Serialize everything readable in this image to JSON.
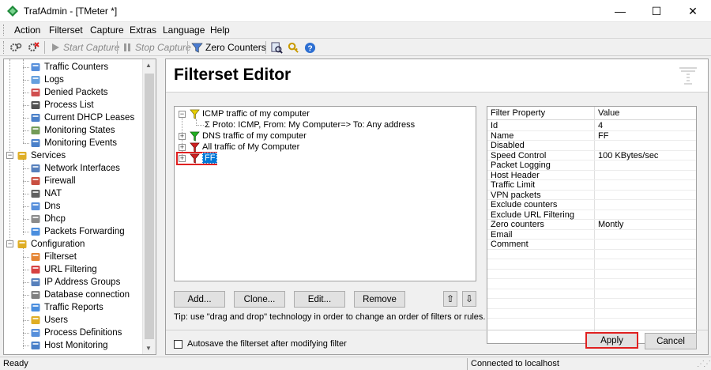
{
  "window": {
    "title": "TrafAdmin - [TMeter *]",
    "minimize_glyph": "—",
    "maximize_glyph": "☐",
    "close_glyph": "✕"
  },
  "menu": [
    "Action",
    "Filterset",
    "Capture",
    "Extras",
    "Language",
    "Help"
  ],
  "toolbar": {
    "start_capture": "Start Capture",
    "stop_capture": "Stop Capture",
    "zero_counters": "Zero Counters"
  },
  "tree": {
    "items": [
      {
        "label": "Traffic Counters",
        "icon": "counters-icon"
      },
      {
        "label": "Logs",
        "icon": "logs-icon"
      },
      {
        "label": "Denied Packets",
        "icon": "denied-packets-icon"
      },
      {
        "label": "Process List",
        "icon": "process-list-icon"
      },
      {
        "label": "Current DHCP Leases",
        "icon": "dhcp-leases-icon"
      },
      {
        "label": "Monitoring States",
        "icon": "monitoring-states-icon"
      },
      {
        "label": "Monitoring Events",
        "icon": "monitoring-events-icon"
      },
      {
        "label": "Services",
        "icon": "services-gear-icon"
      },
      {
        "label": "Network Interfaces",
        "icon": "network-interfaces-icon"
      },
      {
        "label": "Firewall",
        "icon": "firewall-icon"
      },
      {
        "label": "NAT",
        "icon": "nat-icon"
      },
      {
        "label": "Dns",
        "icon": "dns-icon"
      },
      {
        "label": "Dhcp",
        "icon": "dhcp-icon"
      },
      {
        "label": "Packets Forwarding",
        "icon": "packets-forwarding-icon"
      },
      {
        "label": "Configuration",
        "icon": "configuration-icon"
      },
      {
        "label": "Filterset",
        "icon": "filterset-funnel-icon"
      },
      {
        "label": "URL Filtering",
        "icon": "url-filtering-icon"
      },
      {
        "label": "IP Address Groups",
        "icon": "ip-groups-icon"
      },
      {
        "label": "Database connection",
        "icon": "database-icon"
      },
      {
        "label": "Traffic Reports",
        "icon": "traffic-reports-icon"
      },
      {
        "label": "Users",
        "icon": "users-icon"
      },
      {
        "label": "Process Definitions",
        "icon": "process-definitions-icon"
      },
      {
        "label": "Host Monitoring",
        "icon": "host-monitoring-icon"
      }
    ]
  },
  "editor": {
    "title": "Filterset Editor",
    "filters": [
      {
        "label": "ICMP traffic of my computer",
        "color": "#e8d000"
      },
      {
        "label": "Proto: ICMP, From: My Computer=> To: Any address"
      },
      {
        "label": "DNS traffic of my computer",
        "color": "#20b020"
      },
      {
        "label": "All traffic of My Computer",
        "color": "#d02020"
      },
      {
        "label": "FF",
        "color": "#d02020"
      }
    ],
    "property_grid": {
      "headers": [
        "Filter Property",
        "Value"
      ],
      "rows": [
        {
          "name": "Id",
          "value": "4"
        },
        {
          "name": "Name",
          "value": "FF"
        },
        {
          "name": "Disabled",
          "value": ""
        },
        {
          "name": "Speed Control",
          "value": "100 KBytes/sec"
        },
        {
          "name": "Packet Logging",
          "value": ""
        },
        {
          "name": "Host Header",
          "value": ""
        },
        {
          "name": "Traffic Limit",
          "value": ""
        },
        {
          "name": "VPN packets",
          "value": ""
        },
        {
          "name": "Exclude counters",
          "value": ""
        },
        {
          "name": "Exclude URL Filtering",
          "value": ""
        },
        {
          "name": "Zero counters",
          "value": "Montly"
        },
        {
          "name": "Email",
          "value": ""
        },
        {
          "name": "Comment",
          "value": ""
        }
      ]
    },
    "buttons": {
      "add": "Add...",
      "clone": "Clone...",
      "edit": "Edit...",
      "remove": "Remove",
      "move_up": "⇧",
      "move_down": "⇩"
    },
    "tip": "Tip: use \"drag and drop\" technology in order to change an order of filters or rules.",
    "autosave_label": "Autosave the filterset after modifying filter",
    "apply": "Apply",
    "cancel": "Cancel"
  },
  "status": {
    "left": "Ready",
    "right": "Connected to localhost"
  },
  "colors": {
    "highlight_red": "#e02020",
    "selection_blue": "#0078d7"
  }
}
